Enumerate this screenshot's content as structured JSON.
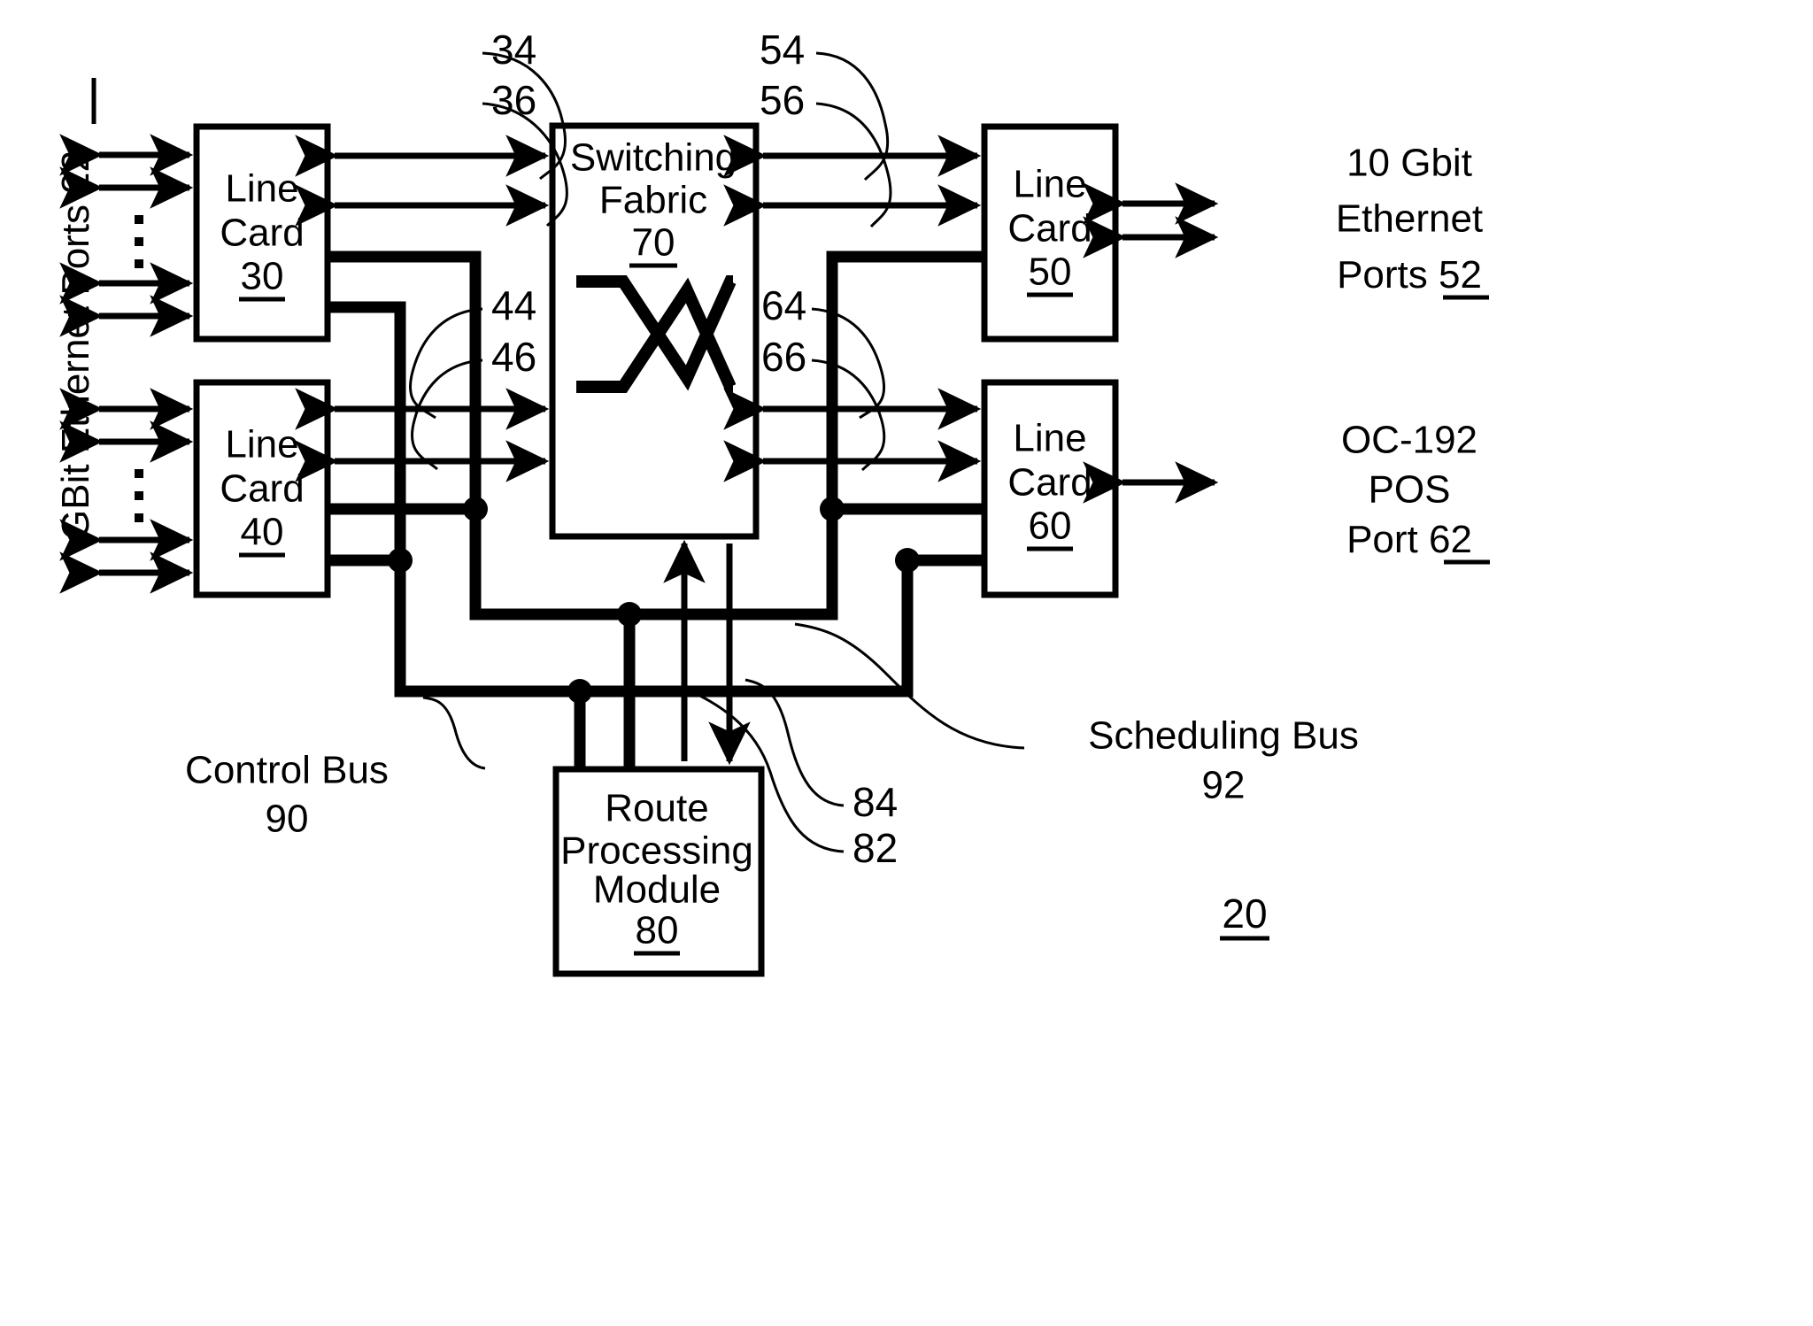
{
  "figure": {
    "number": "20",
    "type": "patent-block-diagram"
  },
  "boxes": {
    "line_card_30": {
      "line1": "Line",
      "line2": "Card",
      "ref": "30"
    },
    "line_card_40": {
      "line1": "Line",
      "line2": "Card",
      "ref": "40"
    },
    "line_card_50": {
      "line1": "Line",
      "line2": "Card",
      "ref": "50"
    },
    "line_card_60": {
      "line1": "Line",
      "line2": "Card",
      "ref": "60"
    },
    "switching_fabric": {
      "line1": "Switching",
      "line2": "Fabric",
      "ref": "70"
    },
    "route_processing_module": {
      "line1": "Route",
      "line2": "Processing",
      "line3": "Module",
      "ref": "80"
    }
  },
  "ports": {
    "left": {
      "text": "GBit Ethernet Ports",
      "ref": "22"
    },
    "right_top": {
      "line1": "10 Gbit",
      "line2": "Ethernet",
      "line3_text": "Ports ",
      "line3_ref": "52"
    },
    "right_bottom": {
      "line1": "OC-192",
      "line2": "POS",
      "line3_text": "Port ",
      "line3_ref": "62"
    }
  },
  "reference_numerals": {
    "n34": "34",
    "n36": "36",
    "n44": "44",
    "n46": "46",
    "n54": "54",
    "n56": "56",
    "n64": "64",
    "n66": "66",
    "n82": "82",
    "n84": "84"
  },
  "buses": {
    "control": {
      "name": "Control Bus",
      "ref": "90"
    },
    "scheduling": {
      "name": "Scheduling Bus",
      "ref": "92"
    }
  },
  "colors": {
    "ink": "#000000",
    "paper": "#ffffff"
  }
}
